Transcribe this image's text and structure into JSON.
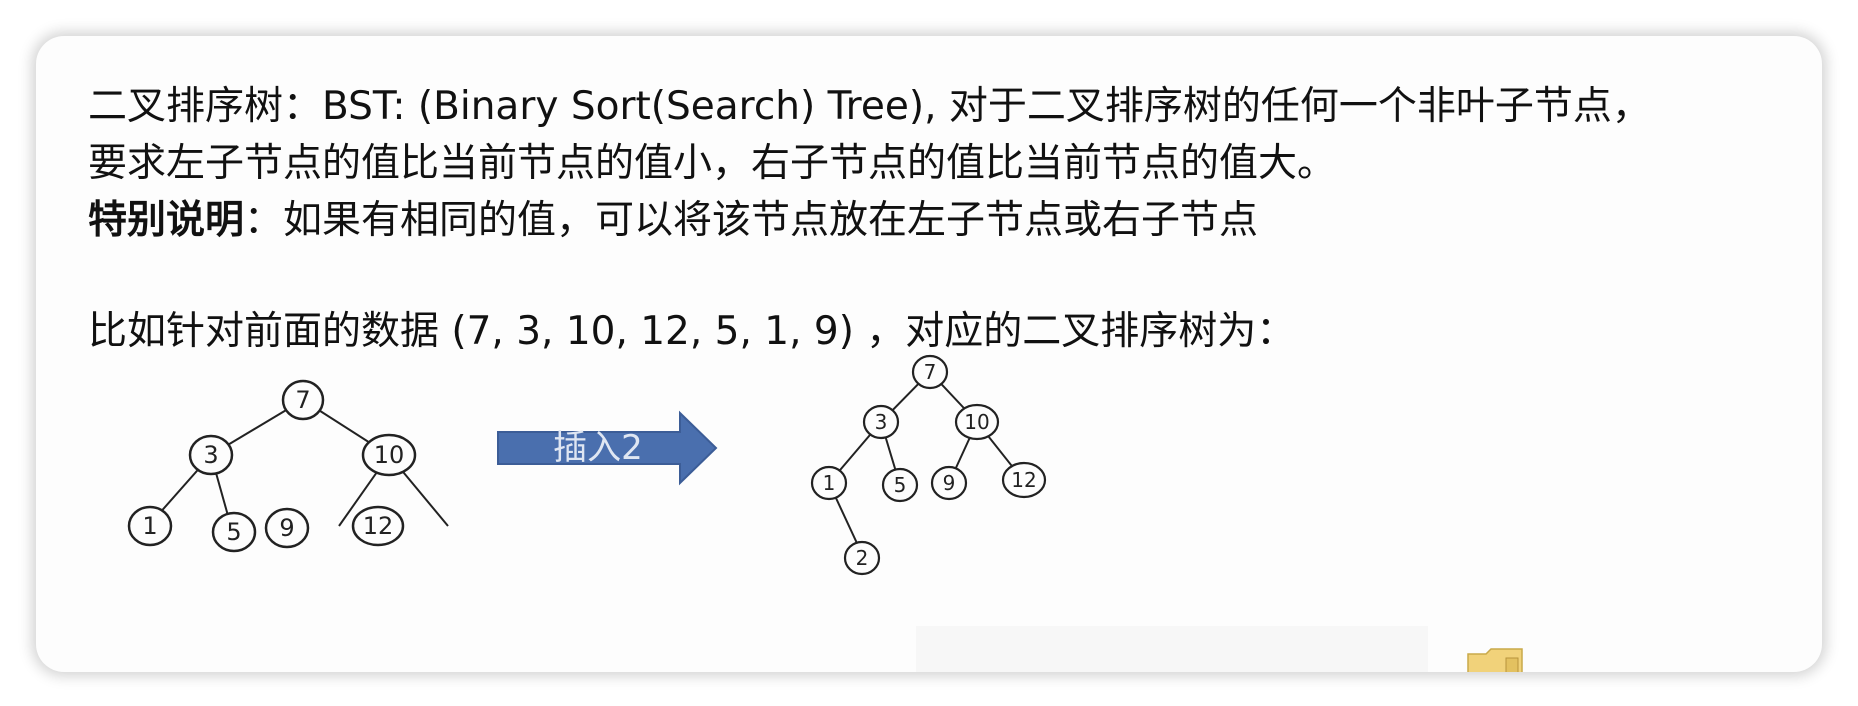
{
  "definition": {
    "line1": "二叉排序树：BST: (Binary Sort(Search) Tree), 对于二叉排序树的任何一个非叶子节点，",
    "line2": "要求左子节点的值比当前节点的值小，右子节点的值比当前节点的值大。",
    "note_label": "特别说明",
    "note_text": "：如果有相同的值，可以将该节点放在左子节点或右子节点"
  },
  "example_intro": "比如针对前面的数据 (7, 3, 10, 12, 5, 1, 9) ，对应的二叉排序树为：",
  "arrow_label": "插入2",
  "tree_before": {
    "nodes": [
      "7",
      "3",
      "10",
      "1",
      "5",
      "9",
      "12"
    ]
  },
  "tree_after": {
    "nodes": [
      "7",
      "3",
      "10",
      "1",
      "5",
      "9",
      "12",
      "2"
    ]
  },
  "colors": {
    "arrow_fill": "#4a6fae",
    "arrow_stroke": "#3c5d97",
    "folder": "#f1d27a"
  },
  "icons": {
    "arrow": "right-arrow-icon",
    "folder": "folder-icon"
  }
}
